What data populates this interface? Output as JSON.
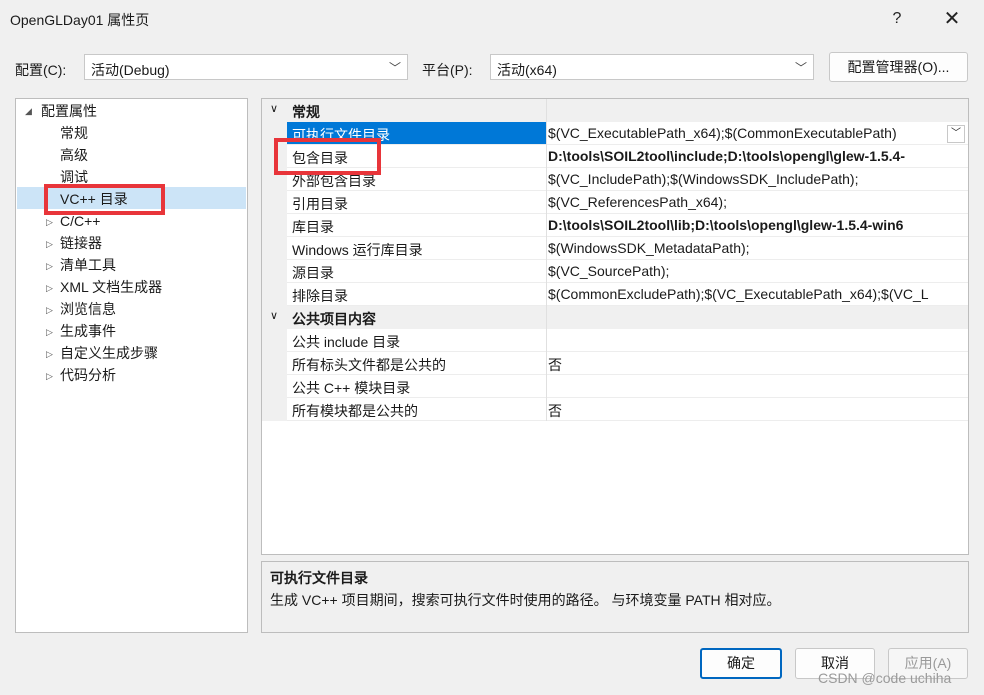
{
  "window": {
    "title": "OpenGLDay01 属性页",
    "help": "?",
    "close": "✕"
  },
  "config": {
    "label": "配置(C):",
    "value": "活动(Debug)"
  },
  "platform": {
    "label": "平台(P):",
    "value": "活动(x64)"
  },
  "config_manager": "配置管理器(O)...",
  "tree": {
    "root": "配置属性",
    "items": [
      "常规",
      "高级",
      "调试",
      "VC++ 目录",
      "C/C++",
      "链接器",
      "清单工具",
      "XML 文档生成器",
      "浏览信息",
      "生成事件",
      "自定义生成步骤",
      "代码分析"
    ]
  },
  "grid": {
    "cat1": "常规",
    "rows1": [
      {
        "name": "可执行文件目录",
        "value": "$(VC_ExecutablePath_x64);$(CommonExecutablePath)"
      },
      {
        "name": "包含目录",
        "value": "D:\\tools\\SOIL2tool\\include;D:\\tools\\opengl\\glew-1.5.4-"
      },
      {
        "name": "外部包含目录",
        "value": "$(VC_IncludePath);$(WindowsSDK_IncludePath);"
      },
      {
        "name": "引用目录",
        "value": "$(VC_ReferencesPath_x64);"
      },
      {
        "name": "库目录",
        "value": "D:\\tools\\SOIL2tool\\lib;D:\\tools\\opengl\\glew-1.5.4-win6"
      },
      {
        "name": "Windows 运行库目录",
        "value": "$(WindowsSDK_MetadataPath);"
      },
      {
        "name": "源目录",
        "value": "$(VC_SourcePath);"
      },
      {
        "name": "排除目录",
        "value": "$(CommonExcludePath);$(VC_ExecutablePath_x64);$(VC_L"
      }
    ],
    "cat2": "公共项目内容",
    "rows2": [
      {
        "name": "公共 include 目录",
        "value": ""
      },
      {
        "name": "所有标头文件都是公共的",
        "value": "否"
      },
      {
        "name": "公共 C++ 模块目录",
        "value": ""
      },
      {
        "name": "所有模块都是公共的",
        "value": "否"
      }
    ]
  },
  "description": {
    "title": "可执行文件目录",
    "body": "生成 VC++ 项目期间，搜索可执行文件时使用的路径。 与环境变量 PATH 相对应。"
  },
  "buttons": {
    "ok": "确定",
    "cancel": "取消",
    "apply": "应用(A)"
  },
  "watermark": "CSDN @code uchiha",
  "colors": {
    "highlight": "#e8353a",
    "selection": "#0078d7",
    "tree_selection": "#cce4f7"
  }
}
